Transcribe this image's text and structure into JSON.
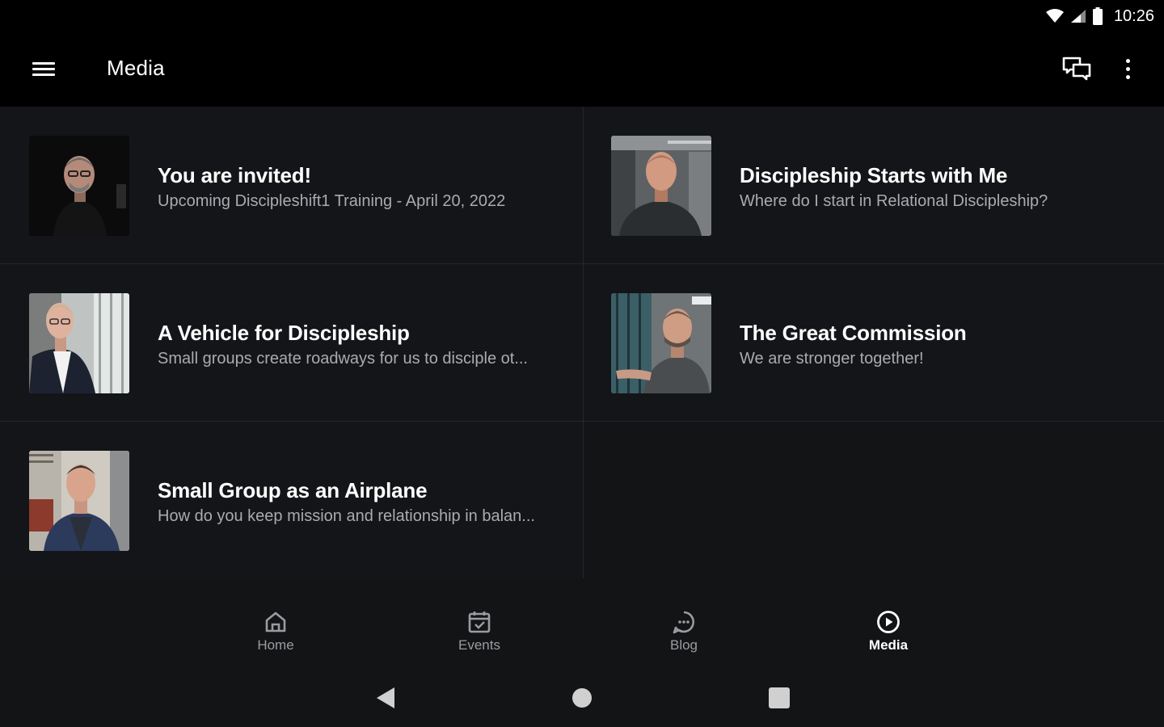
{
  "status_bar": {
    "time": "10:26"
  },
  "app_bar": {
    "title": "Media"
  },
  "items": [
    {
      "title": "You are invited!",
      "subtitle": "Upcoming Discipleshift1 Training - April 20, 2022"
    },
    {
      "title": "Discipleship Starts with Me",
      "subtitle": "Where do I start in Relational Discipleship?"
    },
    {
      "title": "A Vehicle for Discipleship",
      "subtitle": "Small groups create roadways for us to disciple ot..."
    },
    {
      "title": "The Great Commission",
      "subtitle": "We are stronger together!"
    },
    {
      "title": "Small Group as an Airplane",
      "subtitle": "How do you keep mission and relationship in balan..."
    }
  ],
  "bottom_nav": [
    {
      "label": "Home",
      "icon": "home-icon",
      "active": false
    },
    {
      "label": "Events",
      "icon": "calendar-icon",
      "active": false
    },
    {
      "label": "Blog",
      "icon": "chat-bubble-icon",
      "active": false
    },
    {
      "label": "Media",
      "icon": "play-circle-icon",
      "active": true
    }
  ],
  "colors": {
    "background": "#131416",
    "app_bar": "#000000",
    "divider": "#24262a",
    "subtitle": "#a9abb0",
    "nav_inactive": "#9a9ca1",
    "nav_active": "#ffffff"
  }
}
